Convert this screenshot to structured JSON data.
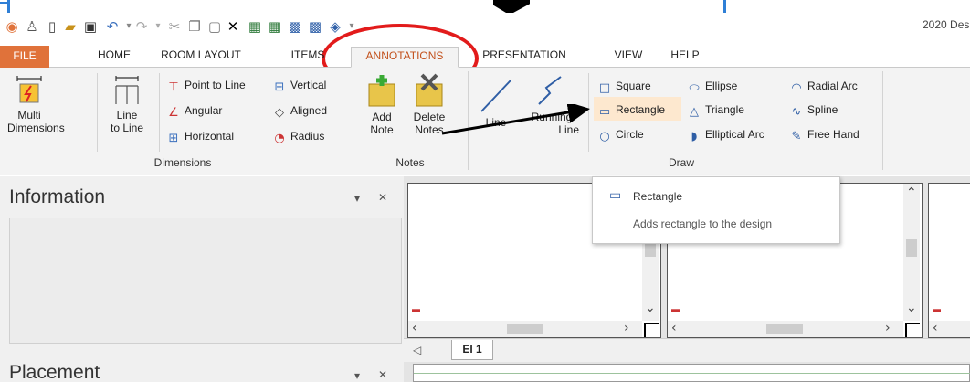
{
  "app": {
    "title": "2020 Des"
  },
  "tabs": [
    {
      "label": "FILE"
    },
    {
      "label": "HOME"
    },
    {
      "label": "ROOM LAYOUT"
    },
    {
      "label": "ITEMS"
    },
    {
      "label": "ANNOTATIONS"
    },
    {
      "label": "PRESENTATION"
    },
    {
      "label": "VIEW"
    },
    {
      "label": "HELP"
    }
  ],
  "ribbon": {
    "dimensions": {
      "label": "Dimensions",
      "multi_line1": "Multi",
      "multi_line2": "Dimensions",
      "line_line1": "Line",
      "line_line2": "to Line",
      "point_to_line": "Point to Line",
      "angular": "Angular",
      "horizontal": "Horizontal",
      "vertical": "Vertical",
      "aligned": "Aligned",
      "radius": "Radius"
    },
    "notes": {
      "label": "Notes",
      "add_line1": "Add",
      "add_line2": "Note",
      "delete_line1": "Delete",
      "delete_line2": "Notes"
    },
    "draw": {
      "label": "Draw",
      "line": "Line",
      "running_line1": "Running",
      "running_line2": "Line",
      "square": "Square",
      "rectangle": "Rectangle",
      "circle": "Circle",
      "ellipse": "Ellipse",
      "triangle": "Triangle",
      "elliptical_arc": "Elliptical Arc",
      "radial_arc": "Radial Arc",
      "spline": "Spline",
      "free_hand": "Free Hand"
    }
  },
  "tooltip": {
    "title": "Rectangle",
    "description": "Adds rectangle to the design"
  },
  "panels": {
    "information": "Information",
    "placement": "Placement",
    "dropdown_glyph": "▾",
    "close_glyph": "✕"
  },
  "views": {
    "tab_label": "El 1"
  },
  "colors": {
    "file_tab": "#e0723a",
    "active_tab_text": "#c2501b",
    "highlight": "#fde8cf",
    "annotation_red": "#e21b1b",
    "accent_blue": "#2f7fd6"
  }
}
